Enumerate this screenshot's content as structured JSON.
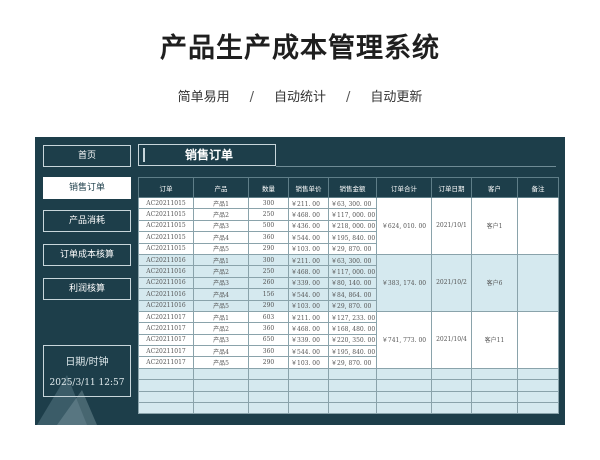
{
  "header": {
    "title": "产品生产成本管理系统",
    "tagline": [
      "简单易用",
      "自动统计",
      "自动更新"
    ],
    "separator": "/"
  },
  "sidebar": {
    "items": [
      {
        "label": "首页",
        "active": false
      },
      {
        "label": "销售订单",
        "active": true
      },
      {
        "label": "产品消耗",
        "active": false
      },
      {
        "label": "订单成本核算",
        "active": false
      },
      {
        "label": "利润核算",
        "active": false
      }
    ],
    "datetime_label": "日期/时钟",
    "datetime_value": "2025/3/11 12:57"
  },
  "section": {
    "title": "销售订单"
  },
  "table": {
    "columns": [
      "订单",
      "产品",
      "数量",
      "销售单价",
      "销售金额",
      "订单合计",
      "订单日期",
      "客户",
      "备注"
    ],
    "groups": [
      {
        "total": "￥624, 010. 00",
        "date": "2021/10/1",
        "customer": "客户1",
        "rows": [
          [
            "AC20211015",
            "产品1",
            "300",
            "￥211. 00",
            "￥63, 300. 00"
          ],
          [
            "AC20211015",
            "产品2",
            "250",
            "￥468. 00",
            "￥117, 000. 00"
          ],
          [
            "AC20211015",
            "产品3",
            "500",
            "￥436. 00",
            "￥218, 000. 00"
          ],
          [
            "AC20211015",
            "产品4",
            "360",
            "￥544. 00",
            "￥195, 840. 00"
          ],
          [
            "AC20211015",
            "产品5",
            "290",
            "￥103. 00",
            "￥29, 870. 00"
          ]
        ]
      },
      {
        "total": "￥383, 174. 00",
        "date": "2021/10/2",
        "customer": "客户6",
        "rows": [
          [
            "AC20211016",
            "产品1",
            "300",
            "￥211. 00",
            "￥63, 300. 00"
          ],
          [
            "AC20211016",
            "产品2",
            "250",
            "￥468. 00",
            "￥117, 000. 00"
          ],
          [
            "AC20211016",
            "产品3",
            "260",
            "￥339. 00",
            "￥80, 140. 00"
          ],
          [
            "AC20211016",
            "产品4",
            "156",
            "￥544. 00",
            "￥84, 864. 00"
          ],
          [
            "AC20211016",
            "产品5",
            "290",
            "￥103. 00",
            "￥29, 870. 00"
          ]
        ]
      },
      {
        "total": "￥741, 773. 00",
        "date": "2021/10/4",
        "customer": "客户11",
        "rows": [
          [
            "AC20211017",
            "产品1",
            "603",
            "￥211. 00",
            "￥127, 233. 00"
          ],
          [
            "AC20211017",
            "产品2",
            "360",
            "￥468. 00",
            "￥168, 480. 00"
          ],
          [
            "AC20211017",
            "产品3",
            "650",
            "￥339. 00",
            "￥220, 350. 00"
          ],
          [
            "AC20211017",
            "产品4",
            "360",
            "￥544. 00",
            "￥195, 840. 00"
          ],
          [
            "AC20211017",
            "产品5",
            "290",
            "￥103. 00",
            "￥29, 870. 00"
          ]
        ]
      }
    ],
    "empty_rows": 4
  },
  "colors": {
    "panel": "#1d3e4a",
    "row_alt": "#d5e9ef",
    "border": "#c8d6db"
  }
}
